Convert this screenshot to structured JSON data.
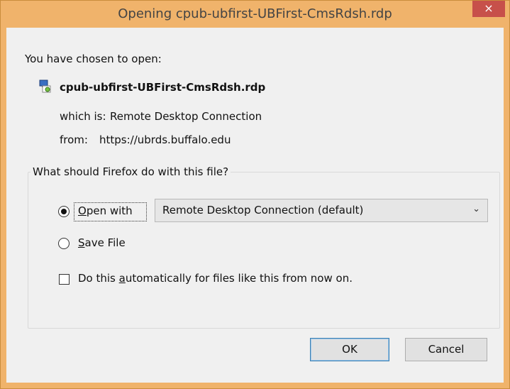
{
  "window": {
    "title": "Opening cpub-ubfirst-UBFirst-CmsRdsh.rdp",
    "close_glyph": "×"
  },
  "content": {
    "intro": "You have chosen to open:",
    "filename": "cpub-ubfirst-UBFirst-CmsRdsh.rdp",
    "which_is_label": "which is:",
    "which_is_value": "Remote Desktop Connection",
    "from_label": "from:",
    "from_value": "https://ubrds.buffalo.edu"
  },
  "group": {
    "label": "What should Firefox do with this file?",
    "open_with": {
      "mnemonic": "O",
      "rest": "pen with",
      "checked": true
    },
    "save_file": {
      "mnemonic": "S",
      "rest": "ave File",
      "checked": false
    },
    "select": {
      "value": "Remote Desktop Connection (default)",
      "chevron_icon": "chevron-down-icon"
    },
    "auto_checkbox": {
      "before": "Do this ",
      "mnemonic": "a",
      "after": "utomatically for files like this from now on.",
      "checked": false
    }
  },
  "buttons": {
    "ok": "OK",
    "cancel": "Cancel"
  },
  "colors": {
    "titlebar": "#f0b36b",
    "close": "#c7504a",
    "client": "#f0f0f0",
    "default_button_border": "#3c7fb1"
  }
}
